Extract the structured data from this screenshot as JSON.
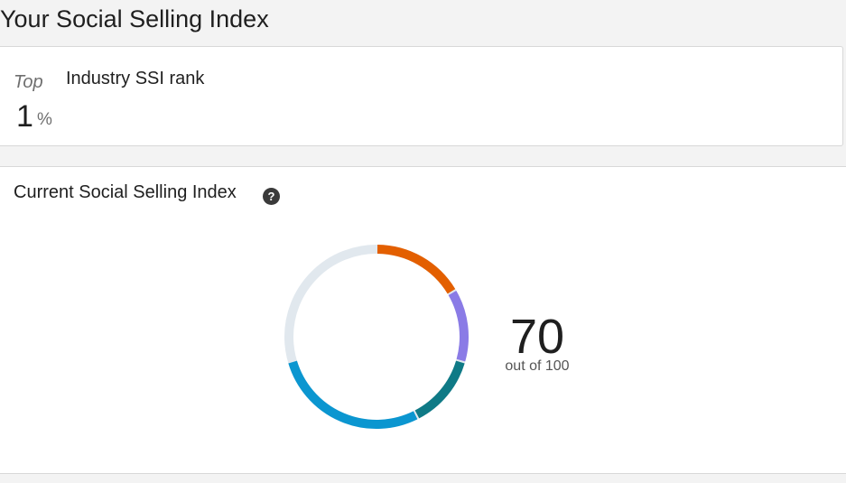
{
  "page": {
    "title": "Your Social Selling Index"
  },
  "rank": {
    "top_label": "Top",
    "value": "1",
    "unit": "%",
    "title": "Industry SSI rank"
  },
  "ssi": {
    "title": "Current Social Selling Index",
    "help_icon": "question-circle-icon",
    "help_glyph": "?",
    "score": "70",
    "caption": "out of 100",
    "track_color": "#e1e8ee",
    "segments": [
      {
        "color": "#e35f00",
        "fraction": 0.165
      },
      {
        "color": "#8a7be6",
        "fraction": 0.13
      },
      {
        "color": "#0f7a86",
        "fraction": 0.13
      },
      {
        "color": "#0b96d0",
        "fraction": 0.28
      }
    ]
  }
}
